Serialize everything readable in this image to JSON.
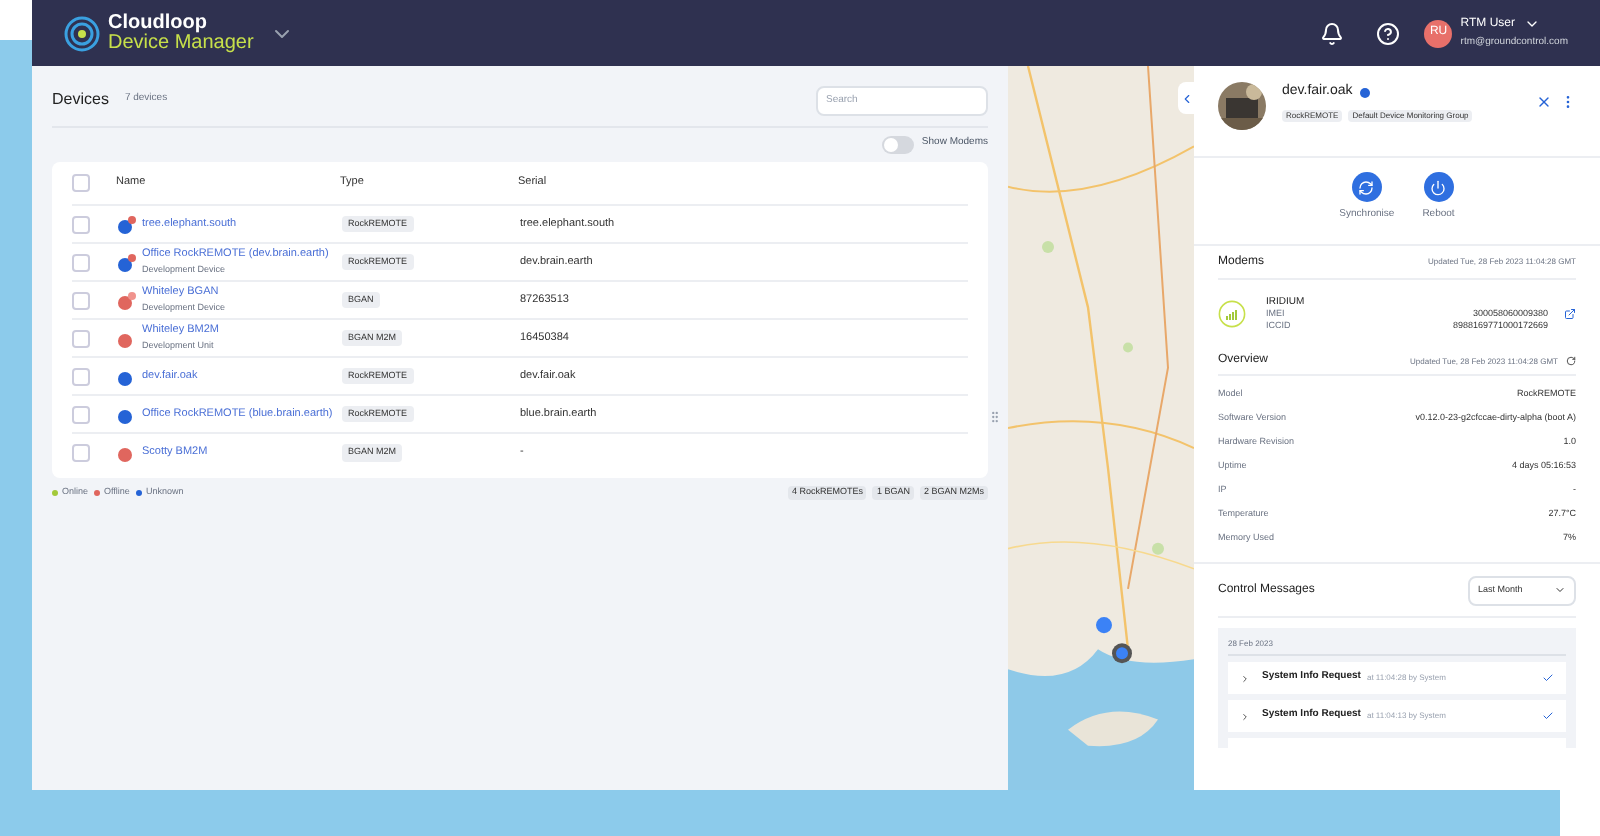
{
  "header": {
    "brand_line1": "Cloudloop",
    "brand_line2": "Device Manager",
    "user_initials": "RU",
    "user_name": "RTM User",
    "user_email": "rtm@groundcontrol.com"
  },
  "devices": {
    "title": "Devices",
    "count": "7 devices",
    "search": {
      "placeholder": "Search"
    },
    "show_modems": {
      "label": "Show Modems",
      "on": false
    },
    "select_all": {
      "checked": false
    },
    "columns": [
      "Name",
      "Type",
      "Serial"
    ],
    "rows": [
      {
        "name": "tree.elephant.south",
        "type": "RockREMOTE",
        "serial": "tree.elephant.south",
        "color": "#2563d6",
        "badge": {
          "color": "#e0665e"
        },
        "checked": false
      },
      {
        "name": "Office RockREMOTE (dev.brain.earth)",
        "subtitle": "Development Device",
        "type": "RockREMOTE",
        "serial": "dev.brain.earth",
        "color": "#2563d6",
        "badge": {
          "color": "#e0665e"
        },
        "checked": false
      },
      {
        "name": "Whiteley BGAN",
        "subtitle": "Development Device",
        "type": "BGAN",
        "serial": "87263513",
        "color": "#e0665e",
        "badge": {
          "color": "#f0938d"
        },
        "checked": false
      },
      {
        "name": "Whiteley BM2M",
        "subtitle": "Development Unit",
        "type": "BGAN M2M",
        "serial": "16450384",
        "color": "#e0665e",
        "checked": false
      },
      {
        "name": "dev.fair.oak",
        "type": "RockREMOTE",
        "serial": "dev.fair.oak",
        "color": "#2563d6",
        "checked": false
      },
      {
        "name": "Office RockREMOTE (blue.brain.earth)",
        "type": "RockREMOTE",
        "serial": "blue.brain.earth",
        "color": "#2563d6",
        "checked": false
      },
      {
        "name": "Scotty BM2M",
        "type": "BGAN M2M",
        "serial": "-",
        "color": "#e0665e",
        "checked": false
      }
    ],
    "legend": [
      {
        "label": "Online",
        "color": "#a3c93a"
      },
      {
        "label": "Offline",
        "color": "#e0665e"
      },
      {
        "label": "Unknown",
        "color": "#2563d6"
      }
    ],
    "summary": [
      "4 RockREMOTEs",
      "1 BGAN",
      "2 BGAN M2Ms"
    ]
  },
  "detail": {
    "name": "dev.fair.oak",
    "tags": [
      "RockREMOTE",
      "Default Device Monitoring Group"
    ],
    "actions": [
      {
        "kind": "sync",
        "label": "Synchronise"
      },
      {
        "kind": "reboot",
        "label": "Reboot"
      }
    ],
    "modems": {
      "title": "Modems",
      "updated": "Updated Tue, 28 Feb 2023 11:04:28 GMT",
      "network": "IRIDIUM",
      "fields": [
        {
          "label": "IMEI",
          "value": "300058060009380"
        },
        {
          "label": "ICCID",
          "value": "8988169771000172669"
        }
      ]
    },
    "overview": {
      "title": "Overview",
      "updated": "Updated Tue, 28 Feb 2023 11:04:28 GMT",
      "fields": [
        {
          "label": "Model",
          "value": "RockREMOTE"
        },
        {
          "label": "Software Version",
          "value": "v0.12.0-23-g2cfccae-dirty-alpha (boot A)"
        },
        {
          "label": "Hardware Revision",
          "value": "1.0"
        },
        {
          "label": "Uptime",
          "value": "4 days 05:16:53"
        },
        {
          "label": "IP",
          "value": "-"
        },
        {
          "label": "Temperature",
          "value": "27.7°C"
        },
        {
          "label": "Memory Used",
          "value": "7%"
        }
      ]
    },
    "control_messages": {
      "title": "Control Messages",
      "range": "Last Month",
      "date": "28 Feb 2023",
      "messages": [
        {
          "title": "System Info Request",
          "meta": "at 11:04:28 by System"
        },
        {
          "title": "System Info Request",
          "meta": "at 11:04:13 by System"
        }
      ]
    }
  }
}
